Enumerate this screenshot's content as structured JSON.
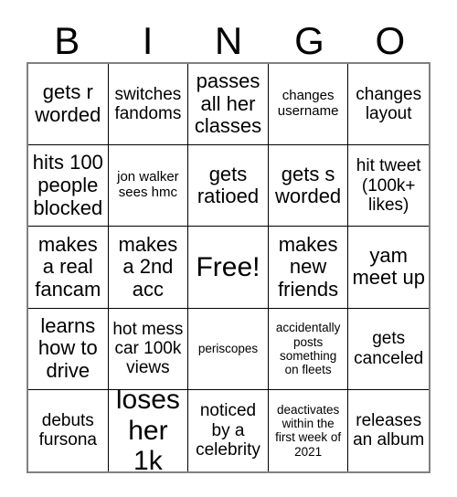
{
  "card": {
    "title": "BINGO",
    "header_letters": [
      "B",
      "I",
      "N",
      "G",
      "O"
    ],
    "grid_size": "5x5",
    "free_space": "Free!",
    "border_color": "#000000",
    "outer_border_color": "#808080",
    "background_color": "#ffffff",
    "text_color": "#000000",
    "rows": [
      {
        "cells": [
          {
            "text": "gets r worded",
            "size": "lg"
          },
          {
            "text": "switches fandoms",
            "size": "md"
          },
          {
            "text": "passes all her classes",
            "size": "lg"
          },
          {
            "text": "changes username",
            "size": "sm"
          },
          {
            "text": "changes layout",
            "size": "md"
          }
        ]
      },
      {
        "cells": [
          {
            "text": "hits 100 people blocked",
            "size": "lg"
          },
          {
            "text": "jon walker sees hmc",
            "size": "sm"
          },
          {
            "text": "gets ratioed",
            "size": "lg"
          },
          {
            "text": "gets s worded",
            "size": "lg"
          },
          {
            "text": "hit tweet (100k+ likes)",
            "size": "md"
          }
        ]
      },
      {
        "cells": [
          {
            "text": "makes a real fancam",
            "size": "lg"
          },
          {
            "text": "makes a 2nd acc",
            "size": "lg"
          },
          {
            "text": "Free!",
            "size": "xl"
          },
          {
            "text": "makes new friends",
            "size": "lg"
          },
          {
            "text": "yam meet up",
            "size": "lg"
          }
        ]
      },
      {
        "cells": [
          {
            "text": "learns how to drive",
            "size": "lg"
          },
          {
            "text": "hot mess car 100k views",
            "size": "md"
          },
          {
            "text": "periscopes",
            "size": "xs"
          },
          {
            "text": "accidentally posts something on fleets",
            "size": "xs"
          },
          {
            "text": "gets canceled",
            "size": "md"
          }
        ]
      },
      {
        "cells": [
          {
            "text": "debuts fursona",
            "size": "md"
          },
          {
            "text": "loses her 1k",
            "size": "xl"
          },
          {
            "text": "noticed by a celebrity",
            "size": "md"
          },
          {
            "text": "deactivates within the first week of 2021",
            "size": "xs"
          },
          {
            "text": "releases an album",
            "size": "md"
          }
        ]
      }
    ]
  }
}
